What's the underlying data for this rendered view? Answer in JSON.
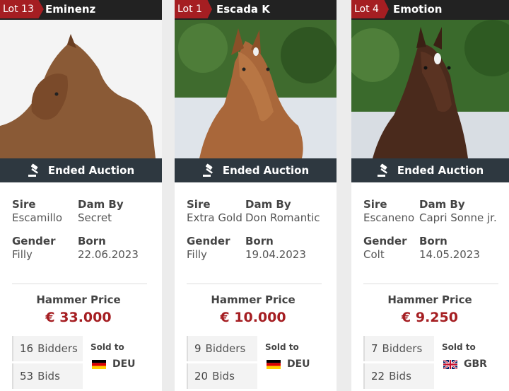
{
  "cards": [
    {
      "lot": "Lot 13",
      "name": "Eminenz",
      "status": "Ended Auction",
      "sire_label": "Sire",
      "sire": "Escamillo",
      "dam_label": "Dam By",
      "dam": "Secret",
      "gender_label": "Gender",
      "gender": "Filly",
      "born_label": "Born",
      "born": "22.06.2023",
      "hammer_label": "Hammer Price",
      "hammer": "€ 33.000",
      "bidders_count": "16",
      "bidders_label": "Bidders",
      "bids_count": "53",
      "bids_label": "Bids",
      "sold_label": "Sold to",
      "country": "DEU",
      "flag": "germany-flag-icon"
    },
    {
      "lot": "Lot 1",
      "name": "Escada K",
      "status": "Ended Auction",
      "sire_label": "Sire",
      "sire": "Extra Gold",
      "dam_label": "Dam By",
      "dam": "Don Romantic",
      "gender_label": "Gender",
      "gender": "Filly",
      "born_label": "Born",
      "born": "19.04.2023",
      "hammer_label": "Hammer Price",
      "hammer": "€ 10.000",
      "bidders_count": "9",
      "bidders_label": "Bidders",
      "bids_count": "20",
      "bids_label": "Bids",
      "sold_label": "Sold to",
      "country": "DEU",
      "flag": "germany-flag-icon"
    },
    {
      "lot": "Lot 4",
      "name": "Emotion",
      "status": "Ended Auction",
      "sire_label": "Sire",
      "sire": "Escaneno",
      "dam_label": "Dam By",
      "dam": "Capri Sonne jr.",
      "gender_label": "Gender",
      "gender": "Colt",
      "born_label": "Born",
      "born": "14.05.2023",
      "hammer_label": "Hammer Price",
      "hammer": "€ 9.250",
      "bidders_count": "7",
      "bidders_label": "Bidders",
      "bids_count": "22",
      "bids_label": "Bids",
      "sold_label": "Sold to",
      "country": "GBR",
      "flag": "uk-flag-icon"
    }
  ],
  "colors": {
    "accent_red": "#a51e22",
    "status_bar": "#2e3840",
    "header_bar": "#222222"
  }
}
